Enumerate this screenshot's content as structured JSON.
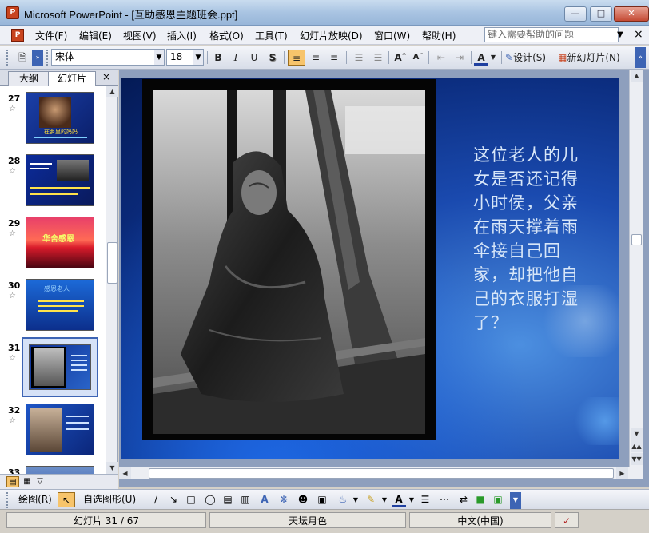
{
  "window": {
    "title": "Microsoft PowerPoint - [互助感恩主题班会.ppt]",
    "app_icon": "P"
  },
  "menu": {
    "items": [
      "文件(F)",
      "编辑(E)",
      "视图(V)",
      "插入(I)",
      "格式(O)",
      "工具(T)",
      "幻灯片放映(D)",
      "窗口(W)",
      "帮助(H)"
    ],
    "help_placeholder": "键入需要帮助的问题"
  },
  "toolbar": {
    "font_name": "宋体",
    "font_size": "18",
    "bold": "B",
    "italic": "I",
    "underline": "U",
    "shadow": "S",
    "design_label": "设计(S)",
    "new_slide_label": "新幻灯片(N)"
  },
  "left_pane": {
    "tab_outline": "大纲",
    "tab_slides": "幻灯片",
    "close": "×",
    "slides": [
      {
        "num": "27",
        "caption": "在乡里的妈妈"
      },
      {
        "num": "28",
        "caption": ""
      },
      {
        "num": "29",
        "caption": "华舍感恩"
      },
      {
        "num": "30",
        "caption": "感恩老人"
      },
      {
        "num": "31",
        "caption": ""
      },
      {
        "num": "32",
        "caption": ""
      },
      {
        "num": "33",
        "caption": ""
      }
    ],
    "selected_slide": "31"
  },
  "slide": {
    "text": "这位老人的儿女是否还记得小时侯，父亲在雨天撑着雨伞接自己回家，却把他自己的衣服打湿了？"
  },
  "drawbar": {
    "draw_label": "绘图(R)",
    "autoshape_label": "自选图形(U)"
  },
  "status": {
    "slide_indicator": "幻灯片 31 / 67",
    "design_name": "天坛月色",
    "language": "中文(中国)"
  },
  "colors": {
    "accent": "#3d64b4",
    "slide_bg": "#1a4aaf",
    "slide_text": "#d7e6f8"
  }
}
